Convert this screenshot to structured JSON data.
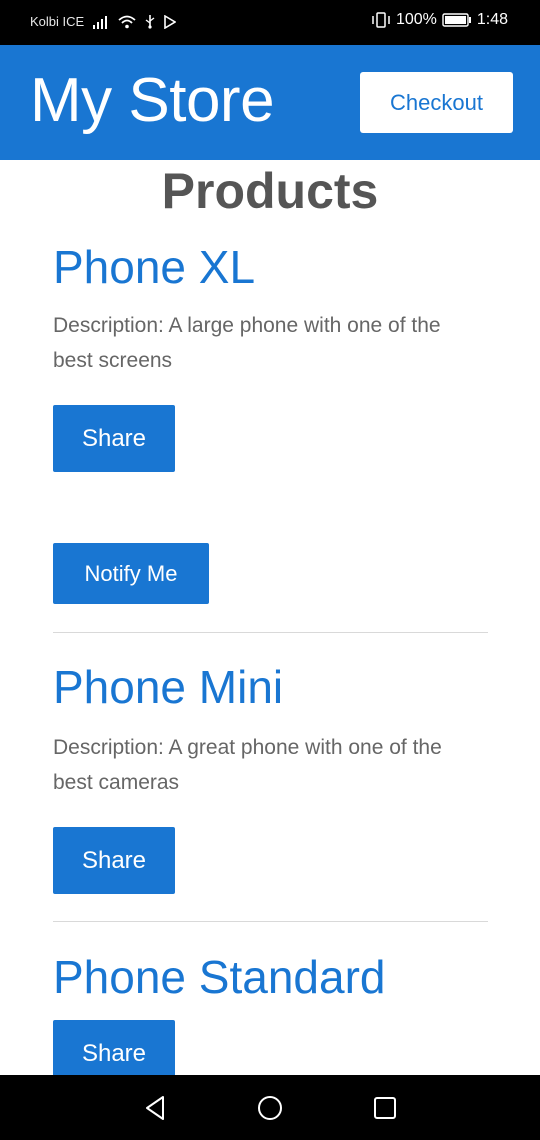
{
  "status_bar": {
    "carrier": "Kolbi ICE",
    "battery": "100%",
    "time": "1:48",
    "icons": [
      "signal-icon",
      "wifi-icon",
      "usb-icon",
      "play-store-icon",
      "vibrate-icon",
      "battery-icon"
    ]
  },
  "header": {
    "title": "My Store",
    "checkout_label": "Checkout",
    "color": "#1976d2"
  },
  "main": {
    "heading": "Products",
    "products": [
      {
        "name": "Phone XL",
        "description": "Description: A large phone with one of the best screens",
        "share_label": "Share",
        "notify_label": "Notify Me"
      },
      {
        "name": "Phone Mini",
        "description": "Description: A great phone with one of the best cameras",
        "share_label": "Share"
      },
      {
        "name": "Phone Standard",
        "share_label": "Share"
      }
    ]
  },
  "nav_bar": {
    "buttons": [
      "back-icon",
      "home-icon",
      "recents-icon"
    ]
  }
}
